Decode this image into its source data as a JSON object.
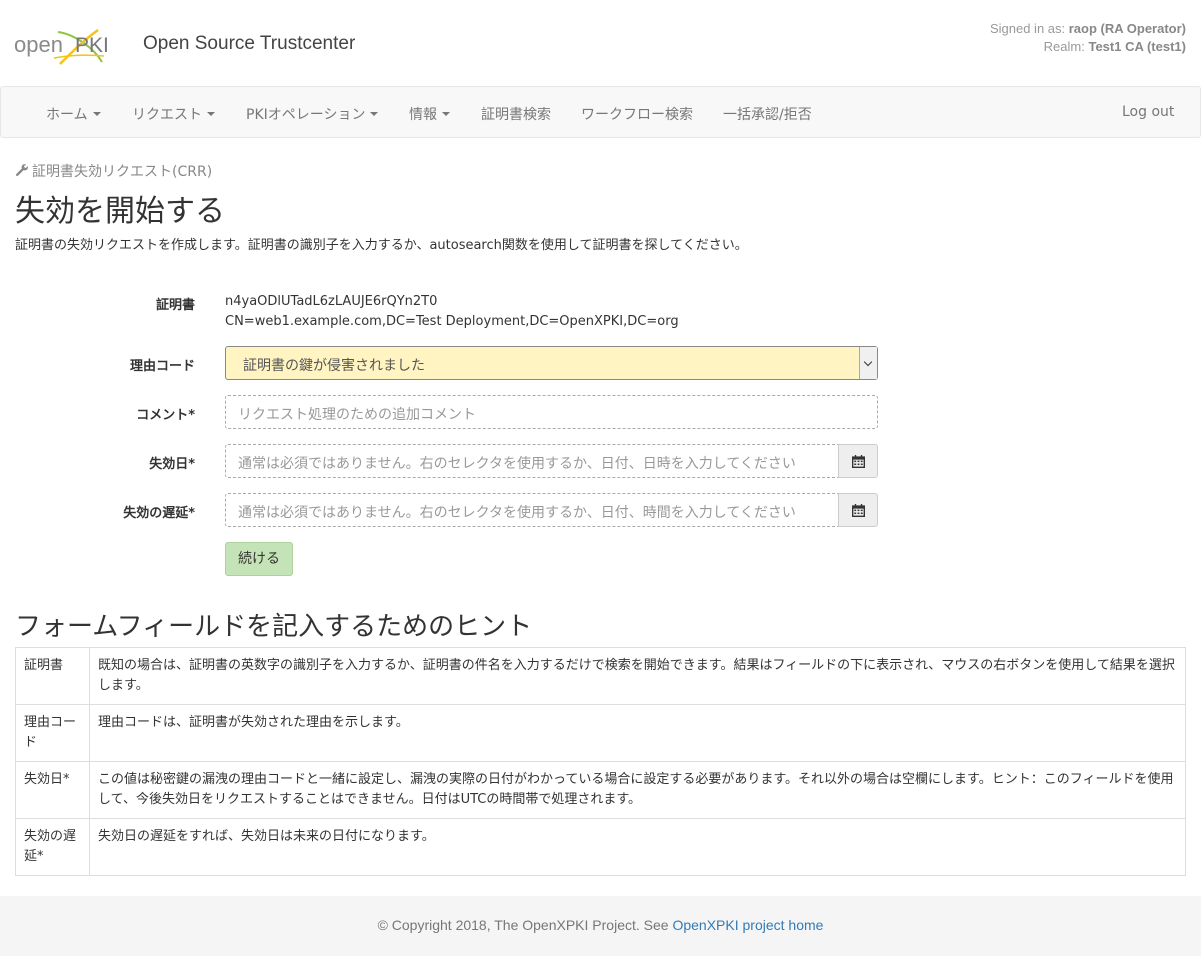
{
  "header": {
    "logo_text_open": "open",
    "logo_text_pki": "PKI",
    "app_title": "Open Source Trustcenter",
    "signed_in_label": "Signed in as: ",
    "signed_in_user": "raop (RA Operator)",
    "realm_label": "Realm: ",
    "realm_value": "Test1 CA (test1)"
  },
  "nav": {
    "items": [
      {
        "label": "ホーム"
      },
      {
        "label": "リクエスト"
      },
      {
        "label": "PKIオペレーション"
      },
      {
        "label": "情報"
      },
      {
        "label": "証明書検索"
      },
      {
        "label": "ワークフロー検索"
      },
      {
        "label": "一括承認/拒否"
      }
    ],
    "logout": "Log out"
  },
  "page": {
    "breadcrumb": "証明書失効リクエスト(CRR)",
    "title": "失効を開始する",
    "description": "証明書の失効リクエストを作成します。証明書の識別子を入力するか、autosearch関数を使用して証明書を探してください。"
  },
  "form": {
    "cert_label": "証明書",
    "cert_id": "n4yaODlUTadL6zLAUJE6rQYn2T0",
    "cert_subject": "CN=web1.example.com,DC=Test Deployment,DC=OpenXPKI,DC=org",
    "reason_label": "理由コード",
    "reason_value": "証明書の鍵が侵害されました",
    "comment_label": "コメント*",
    "comment_placeholder": "リクエスト処理のための追加コメント",
    "invalidity_label": "失効日*",
    "invalidity_placeholder": "通常は必須ではありません。右のセレクタを使用するか、日付、日時を入力してください",
    "delay_label": "失効の遅延*",
    "delay_placeholder": "通常は必須ではありません。右のセレクタを使用するか、日付、時間を入力してください",
    "submit": "続ける"
  },
  "hints": {
    "title": "フォームフィールドを記入するためのヒント",
    "rows": [
      {
        "key": "証明書",
        "text": "既知の場合は、証明書の英数字の識別子を入力するか、証明書の件名を入力するだけで検索を開始できます。結果はフィールドの下に表示され、マウスの右ボタンを使用して結果を選択します。"
      },
      {
        "key": "理由コード",
        "text": "理由コードは、証明書が失効された理由を示します。"
      },
      {
        "key": "失効日*",
        "text": "この値は秘密鍵の漏洩の理由コードと一緒に設定し、漏洩の実際の日付がわかっている場合に設定する必要があります。それ以外の場合は空欄にします。ヒント：このフィールドを使用して、今後失効日をリクエストすることはできません。日付はUTCの時間帯で処理されます。"
      },
      {
        "key": "失効の遅延*",
        "text": "失効日の遅延をすれば、失効日は未来の日付になります。"
      }
    ]
  },
  "footer": {
    "copyright": "© Copyright 2018, The OpenXPKI Project. See ",
    "link": "OpenXPKI project home"
  },
  "icons": {
    "breadcrumb": "wrench-icon",
    "calendar": "calendar-icon"
  }
}
